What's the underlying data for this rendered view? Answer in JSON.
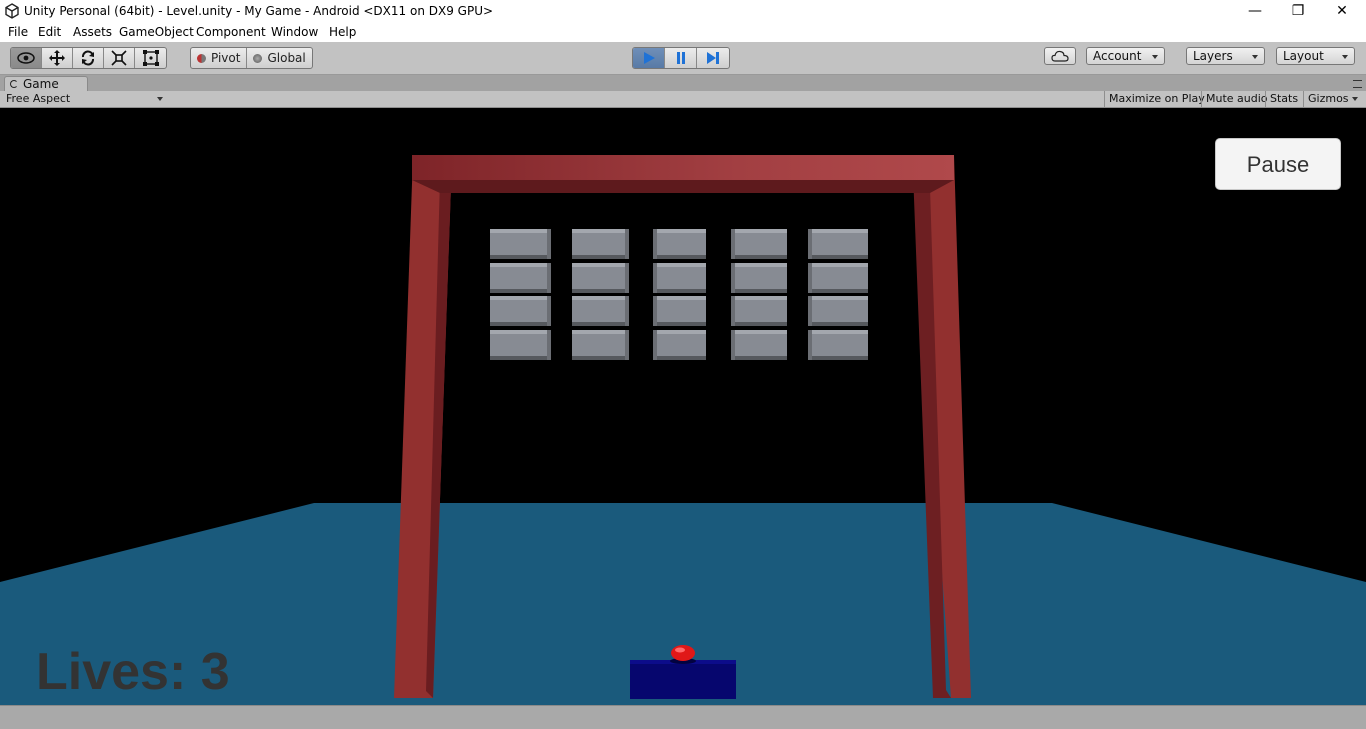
{
  "window": {
    "title": "Unity Personal (64bit) - Level.unity - My Game - Android <DX11 on DX9 GPU>",
    "controls": {
      "minimize": "—",
      "restore": "❐",
      "close": "✕"
    }
  },
  "menu": [
    "File",
    "Edit",
    "Assets",
    "GameObject",
    "Component",
    "Window",
    "Help"
  ],
  "toolbar": {
    "transform_tools": [
      "view-hand-icon",
      "move-icon",
      "rotate-icon",
      "scale-icon",
      "rect-transform-icon"
    ],
    "pivot_label": "Pivot",
    "global_label": "Global",
    "play_controls": [
      "play-icon",
      "pause-icon",
      "step-icon"
    ],
    "account_label": "Account",
    "layers_label": "Layers",
    "layout_label": "Layout"
  },
  "game_panel": {
    "tab_label": "Game",
    "aspect_label": "Free Aspect",
    "maximize_label": "Maximize on Play",
    "mute_label": "Mute audio",
    "stats_label": "Stats",
    "gizmos_label": "Gizmos"
  },
  "game": {
    "pause_label": "Pause",
    "lives_text": "Lives: 3",
    "brick_rows": 4,
    "brick_columns": 5
  },
  "colors": {
    "play_active": "#5d7fae",
    "floor": "#1a5a7c",
    "frame": "#8e2d31",
    "paddle": "#06066e",
    "ball": "#e01818",
    "brick": "#8a8e96"
  }
}
